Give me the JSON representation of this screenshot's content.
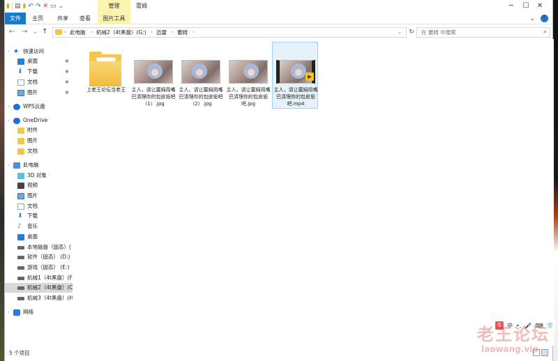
{
  "window": {
    "title": "蕾姆",
    "manage_tab": "管理",
    "minimize": "─",
    "maximize": "☐",
    "close": "✕"
  },
  "quick_access_toolbar": {
    "icons": [
      "folder-icon",
      "properties-icon",
      "new-folder-icon",
      "undo-icon",
      "redo-icon",
      "delete-icon",
      "rename-icon",
      "customize-icon"
    ]
  },
  "ribbon": {
    "tabs": [
      {
        "label": "文件"
      },
      {
        "label": "主页"
      },
      {
        "label": "共享"
      },
      {
        "label": "查看"
      },
      {
        "label": "图片工具"
      }
    ],
    "expand_icon": "⌄",
    "help_icon": "?"
  },
  "nav_buttons": {
    "back": "←",
    "forward": "→",
    "recent": "⌄",
    "up": "↑"
  },
  "address": {
    "segments": [
      "此电脑",
      "机械2（4t黑盘）(G:)",
      "迅雷",
      "蕾姆"
    ],
    "separator": "›",
    "dropdown": "⌄"
  },
  "search": {
    "placeholder": "在 蕾姆 中搜索",
    "icon": "⌕",
    "refresh": "↻"
  },
  "navpane": {
    "items": [
      {
        "label": "快速访问",
        "icon": "star-icon",
        "pinned": false
      },
      {
        "label": "桌面",
        "icon": "desktop-icon",
        "pinned": true
      },
      {
        "label": "下载",
        "icon": "download-icon",
        "pinned": true
      },
      {
        "label": "文档",
        "icon": "documents-icon",
        "pinned": true
      },
      {
        "label": "图片",
        "icon": "pictures-icon",
        "pinned": true
      },
      {
        "label": "WPS云盘",
        "icon": "cloud-icon",
        "pinned": false
      },
      {
        "label": "OneDrive",
        "icon": "cloud-icon",
        "pinned": false
      },
      {
        "label": "附件",
        "icon": "folder-icon",
        "pinned": false
      },
      {
        "label": "图片",
        "icon": "folder-icon",
        "pinned": false
      },
      {
        "label": "文档",
        "icon": "folder-icon",
        "pinned": false
      },
      {
        "label": "此电脑",
        "icon": "computer-icon",
        "pinned": false
      },
      {
        "label": "3D 对象",
        "icon": "3d-objects-icon",
        "pinned": false
      },
      {
        "label": "视频",
        "icon": "videos-icon",
        "pinned": false
      },
      {
        "label": "图片",
        "icon": "pictures-icon",
        "pinned": false
      },
      {
        "label": "文档",
        "icon": "documents-icon",
        "pinned": false
      },
      {
        "label": "下载",
        "icon": "download-icon",
        "pinned": false
      },
      {
        "label": "音乐",
        "icon": "music-icon",
        "pinned": false
      },
      {
        "label": "桌面",
        "icon": "desktop-icon",
        "pinned": false
      },
      {
        "label": "本地磁盘（固态）(",
        "icon": "drive-icon",
        "pinned": false
      },
      {
        "label": "软件（固态） (D:)",
        "icon": "drive-icon",
        "pinned": false
      },
      {
        "label": "游戏（固态） (E:)",
        "icon": "drive-icon",
        "pinned": false
      },
      {
        "label": "机械1（4t黑盘）(F",
        "icon": "drive-icon",
        "pinned": false
      },
      {
        "label": "机械2（4t黑盘）(C",
        "icon": "drive-icon",
        "pinned": false,
        "selected": true
      },
      {
        "label": "机械3（4t黑盘）(H",
        "icon": "drive-icon",
        "pinned": false
      },
      {
        "label": "网络",
        "icon": "network-icon",
        "pinned": false
      }
    ],
    "pin_glyph": "✱",
    "chevron_glyph": "›"
  },
  "files": [
    {
      "name": "上老王论坛当老王",
      "type": "folder"
    },
    {
      "name": "主人，请让蕾姆用嘴巴清理你的包皮垢吧（1）.jpg",
      "type": "image"
    },
    {
      "name": "主人，请让蕾姆用嘴巴清理你的包皮垢吧（2）.jpg",
      "type": "image"
    },
    {
      "name": "主人，请让蕾姆用嘴巴清理你的包皮垢吧.jpg",
      "type": "image"
    },
    {
      "name": "主人，请让蕾姆用嘴巴清理你的包皮垢吧.mp4",
      "type": "video",
      "selected": true
    }
  ],
  "status": {
    "item_count": "5 个项目"
  },
  "ime": {
    "logo": "S",
    "lang": "中",
    "punct": "•,",
    "mic": "🎤",
    "keyboard": "⌨",
    "skin": "👕"
  },
  "watermark": {
    "cn": "老王论坛",
    "url": "laowang.vip"
  }
}
